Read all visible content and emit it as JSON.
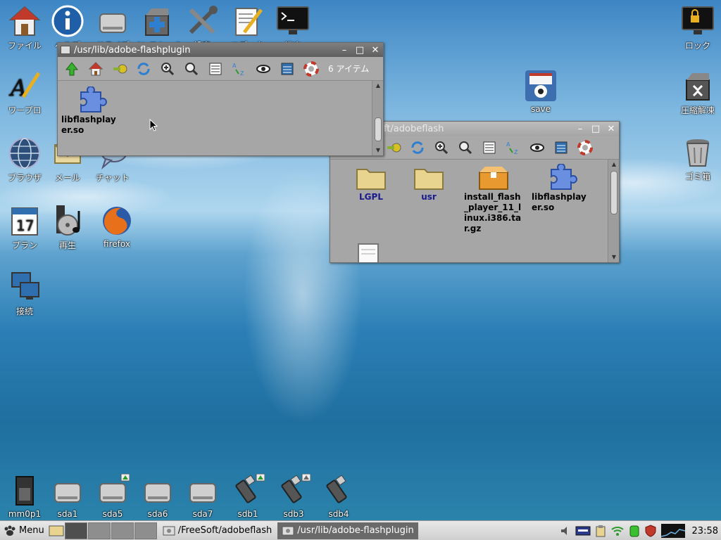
{
  "desktop": {
    "top_icons": [
      {
        "label": "ファイル",
        "icon": "home-folder-icon"
      },
      {
        "label": "ヘルプ",
        "icon": "info-icon"
      },
      {
        "label": "ドライブ",
        "icon": "drive-icon"
      },
      {
        "label": "インストール",
        "icon": "package-install-icon"
      },
      {
        "label": "設定",
        "icon": "tools-icon"
      },
      {
        "label": "エディタ",
        "icon": "text-editor-icon"
      },
      {
        "label": "端末",
        "icon": "terminal-icon"
      }
    ],
    "left_icons": [
      {
        "label": "ワープロ",
        "icon": "word-processor-icon"
      },
      {
        "label": "ブラウザ",
        "icon": "globe-icon"
      },
      {
        "label": "メール",
        "icon": "mail-icon"
      },
      {
        "label": "チャット",
        "icon": "chat-icon"
      },
      {
        "label": "プラン",
        "icon": "calendar-icon"
      },
      {
        "label": "再生",
        "icon": "media-player-icon"
      },
      {
        "label": "firefox",
        "icon": "firefox-icon"
      },
      {
        "label": "接続",
        "icon": "network-connect-icon"
      }
    ],
    "right_icons": [
      {
        "label": "ロック",
        "icon": "lock-screen-icon"
      },
      {
        "label": "save",
        "icon": "save-icon"
      },
      {
        "label": "圧縮解凍",
        "icon": "archive-icon"
      },
      {
        "label": "ゴミ箱",
        "icon": "trash-icon"
      }
    ],
    "drives": [
      "mm0p1",
      "sda1",
      "sda5",
      "sda6",
      "sda7",
      "sdb1",
      "sdb3",
      "sdb4"
    ]
  },
  "window_front": {
    "title": "/usr/lib/adobe-flashplugin",
    "item_count": "6 アイテム",
    "files": [
      {
        "name_line1": "libflashplay",
        "name_line2": "er.so",
        "icon": "puzzle-plugin-icon"
      }
    ]
  },
  "window_back": {
    "title": "/FreeSoft/adobeflash",
    "visible_title": "oft/adobeflash",
    "files": [
      {
        "name": "LGPL",
        "icon": "folder-icon"
      },
      {
        "name": "usr",
        "icon": "folder-icon"
      },
      {
        "name_lines": [
          "install_flash",
          "_player_11_l",
          "inux.i386.ta",
          "r.gz"
        ],
        "icon": "archive-package-icon"
      },
      {
        "name_lines": [
          "libflashplay",
          "er.so"
        ],
        "icon": "puzzle-plugin-icon"
      }
    ]
  },
  "taskbar": {
    "menu_label": "Menu",
    "tasks": [
      {
        "label": "/FreeSoft/adobeflash",
        "active": false
      },
      {
        "label": "/usr/lib/adobe-flashplugin",
        "active": true
      }
    ],
    "clock": "23:58"
  },
  "colors": {
    "folder": "#e8d38f",
    "puzzle": "#6a8fe0",
    "titlebar_active": "#6a6a6a",
    "window_bg": "#a6a6a6"
  }
}
